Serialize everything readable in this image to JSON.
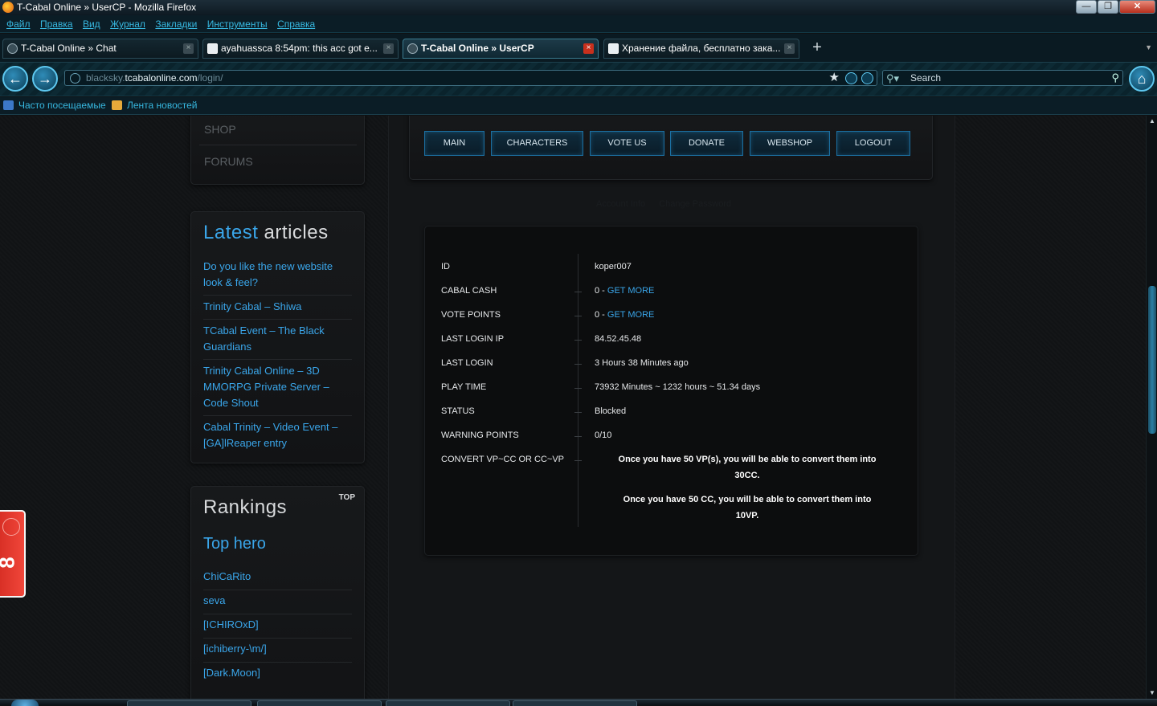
{
  "window": {
    "title": "T-Cabal Online » UserCP - Mozilla Firefox",
    "buttons": {
      "minimize": "—",
      "maximize": "❐",
      "close": "✕"
    }
  },
  "menubar": [
    "Файл",
    "Правка",
    "Вид",
    "Журнал",
    "Закладки",
    "Инструменты",
    "Справка"
  ],
  "tabs": [
    {
      "label": "T-Cabal Online » Chat",
      "active": false,
      "icon": "site-icon"
    },
    {
      "label": "ayahuassca 8:54pm: this acc got e...",
      "active": false,
      "icon": "chat-icon"
    },
    {
      "label": "T-Cabal Online » UserCP",
      "active": true,
      "icon": "site-icon"
    },
    {
      "label": "Хранение файла, бесплатно зака...",
      "active": false,
      "icon": "file-host-icon"
    }
  ],
  "navbar": {
    "url_prefix": "blacksky.",
    "url_domain": "tcabalonline.com",
    "url_path": "/login/",
    "search_placeholder": "Search"
  },
  "bookmarks": [
    "Часто посещаемые",
    "Лента новостей"
  ],
  "sidebar": {
    "nav_items": [
      "SHOP",
      "FORUMS"
    ],
    "articles_title_a": "Latest",
    "articles_title_b": " articles",
    "articles": [
      "Do you like the new website look & feel?",
      "Trinity Cabal – Shiwa",
      "TCabal Event – The Black Guardians",
      "Trinity Cabal Online – 3D MMORPG Private Server – Code Shout",
      "Cabal Trinity – Video Event – [GA]lReaper entry"
    ],
    "rankings_title": "Rankings",
    "rankings_tag": "TOP",
    "rankings_subtitle": "Top hero",
    "rankings": [
      "ChiCaRito",
      "seva",
      "[ICHIROxD]",
      "[ichiberry-\\m/]",
      "[Dark.Moon]"
    ]
  },
  "side_widget": {
    "label": "8"
  },
  "main_menu": [
    "MAIN",
    "CHARACTERS",
    "VOTE US",
    "DONATE",
    "WEBSHOP",
    "LOGOUT"
  ],
  "subtabs": [
    "Account Info",
    "Change Password"
  ],
  "account": {
    "rows": [
      {
        "label": "ID",
        "value": "koper007",
        "link": ""
      },
      {
        "label": "CABAL CASH",
        "value": "0 - ",
        "link": "GET MORE"
      },
      {
        "label": "VOTE POINTS",
        "value": "0 - ",
        "link": "GET MORE"
      },
      {
        "label": "LAST LOGIN IP",
        "value": "84.52.45.48",
        "link": ""
      },
      {
        "label": "LAST LOGIN",
        "value": "3 Hours 38 Minutes ago",
        "link": ""
      },
      {
        "label": "PLAY TIME",
        "value": "73932 Minutes ~ 1232 hours ~ 51.34 days",
        "link": ""
      },
      {
        "label": "STATUS",
        "value": "Blocked",
        "link": ""
      },
      {
        "label": "WARNING POINTS",
        "value": "0/10",
        "link": ""
      },
      {
        "label": "CONVERT VP~CC OR CC~VP",
        "value": "",
        "link": ""
      }
    ],
    "convert_vp_line1": "Once you have 50 VP(s), you will be able to convert them into",
    "convert_vp_line2": "30CC.",
    "convert_cc_line1": "Once you have 50 CC, you will be able to convert them into",
    "convert_cc_line2": "10VP."
  },
  "colors": {
    "accent": "#3aa6ea",
    "button_border": "#1b6fa1",
    "status_blocked": "#e6e8ea"
  }
}
